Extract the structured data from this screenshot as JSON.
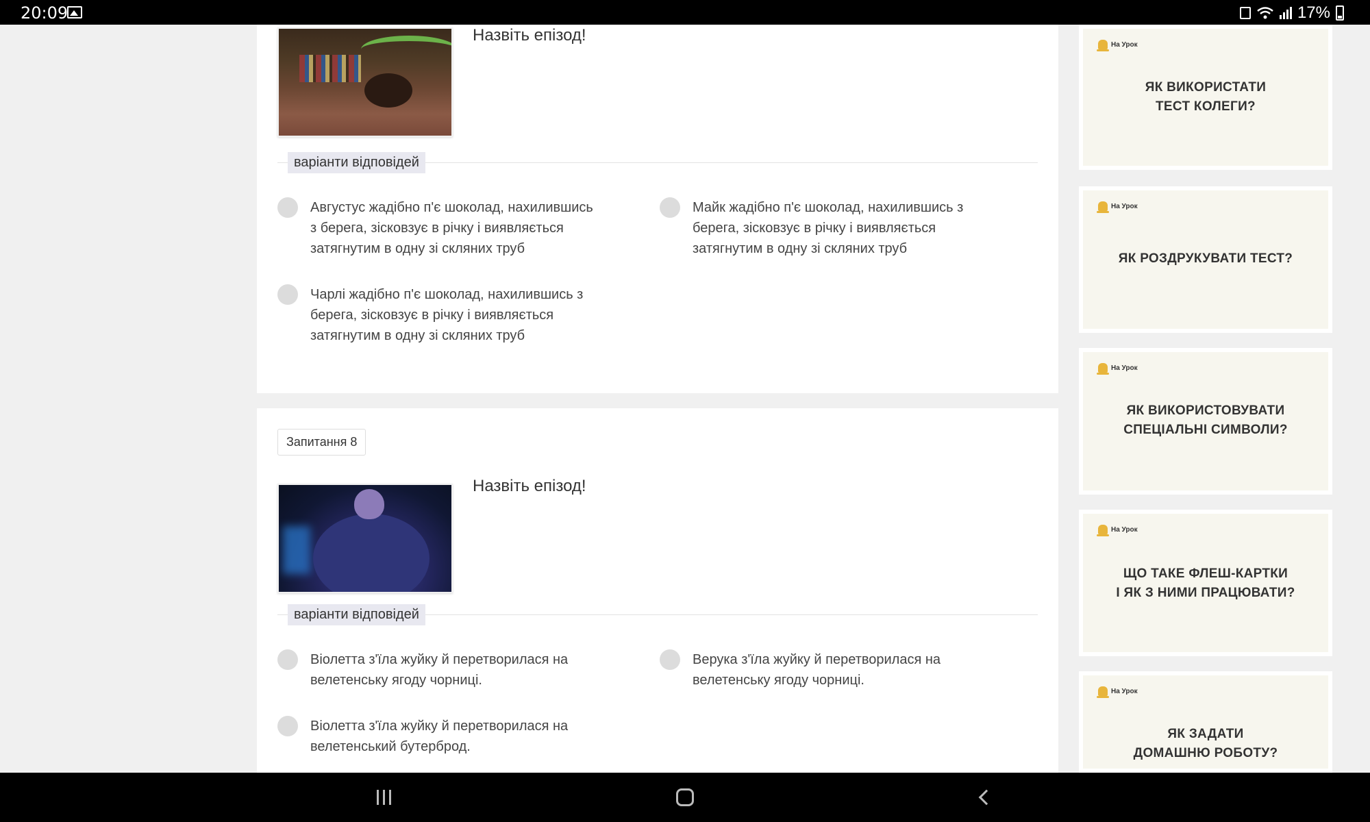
{
  "status_bar": {
    "time": "20:09",
    "battery": "17%"
  },
  "questions": [
    {
      "badge": "",
      "prompt": "Назвіть епізод!",
      "image_icon": "chocolate-river-image",
      "answers_label": "варіанти відповідей",
      "answers": [
        "Августус жадібно п'є шоколад, нахилившись з берега, зісковзує в річку і виявляється затягнутим в одну зі скляних труб",
        "Майк жадібно п'є шоколад, нахилившись з берега, зісковзує в річку і виявляється затягнутим в одну зі скляних труб",
        "Чарлі жадібно п'є шоколад, нахилившись з берега, зісковзує в річку і виявляється затягнутим в одну зі скляних труб"
      ]
    },
    {
      "badge": "Запитання 8",
      "prompt": "Назвіть епізод!",
      "image_icon": "blueberry-girl-image",
      "answers_label": "варіанти відповідей",
      "answers": [
        "Віолетта з'їла жуйку й перетворилася на велетенську ягоду чорниці.",
        "Верука з'їла жуйку й перетворилася на велетенську ягоду чорниці.",
        "Віолетта з'їла жуйку й перетворилася на велетенський бутерброд."
      ]
    }
  ],
  "sidebar": {
    "logo_text": "На Урок",
    "promos": [
      {
        "line1": "ЯК ВИКОРИСТАТИ",
        "line2": "ТЕСТ КОЛЕГИ?"
      },
      {
        "line1": "ЯК РОЗДРУКУВАТИ ТЕСТ?",
        "line2": ""
      },
      {
        "line1": "ЯК ВИКОРИСТОВУВАТИ",
        "line2": "СПЕЦІАЛЬНІ СИМВОЛИ?"
      },
      {
        "line1": "ЩО ТАКЕ ФЛЕШ-КАРТКИ",
        "line2": "І ЯК З НИМИ ПРАЦЮВАТИ?"
      },
      {
        "line1": "ЯК ЗАДАТИ",
        "line2": "ДОМАШНЮ РОБОТУ?"
      }
    ]
  },
  "colors": {
    "page_background": "#f0f0f0",
    "card_background": "#ffffff",
    "promo_background": "#f7f6ee",
    "logo_accent": "#e8b53b",
    "radio_fill": "#dcdcdc"
  }
}
